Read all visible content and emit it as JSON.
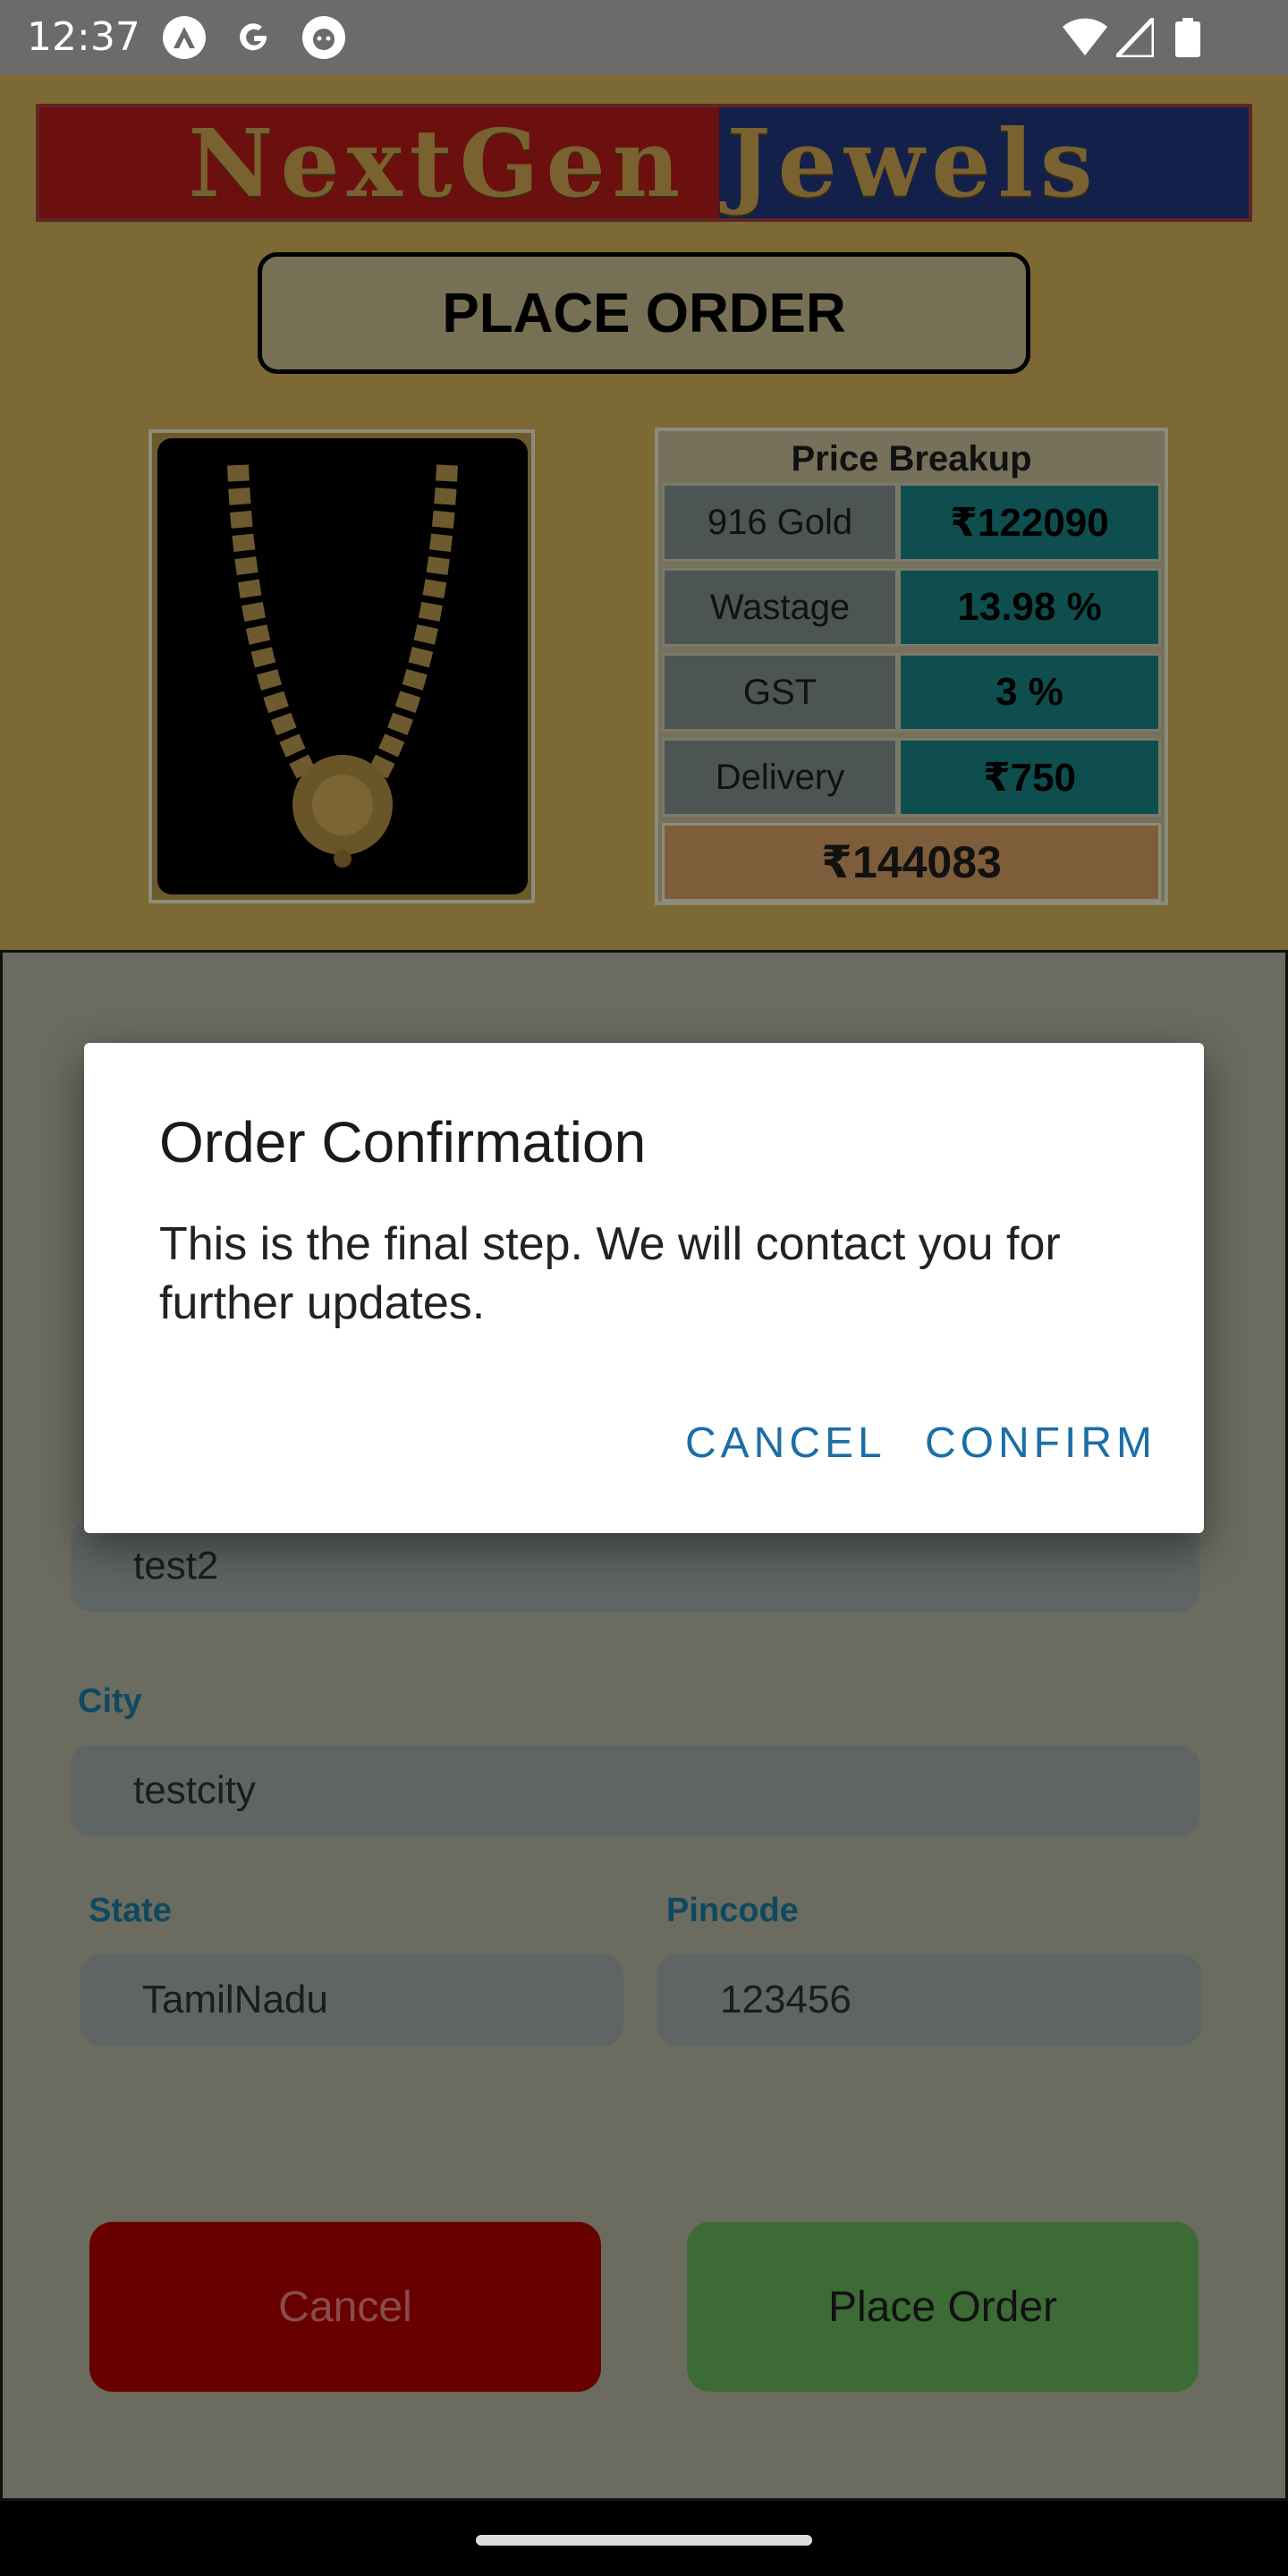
{
  "status_bar": {
    "time": "12:37",
    "left_icons": [
      "app-a-icon",
      "google-g-icon",
      "android-head-icon"
    ],
    "right_icons": [
      "wifi-icon",
      "signal-icon",
      "battery-icon"
    ]
  },
  "brand": {
    "name": "NextGen Jewels",
    "banner_colors": [
      "#6c0f0f",
      "#13214a"
    ]
  },
  "page": {
    "title": "PLACE ORDER"
  },
  "product": {
    "image": "gold-necklace-icon"
  },
  "price_breakup": {
    "header": "Price Breakup",
    "rows": [
      {
        "label": "916 Gold",
        "value": "₹122090"
      },
      {
        "label": "Wastage",
        "value": "13.98 %"
      },
      {
        "label": "GST",
        "value": "3 %"
      },
      {
        "label": "Delivery",
        "value": "₹750"
      }
    ],
    "total": "₹144083"
  },
  "form": {
    "address2": {
      "value": "test2"
    },
    "city": {
      "label": "City",
      "value": "testcity"
    },
    "state": {
      "label": "State",
      "value": "TamilNadu"
    },
    "pincode": {
      "label": "Pincode",
      "value": "123456"
    }
  },
  "actions": {
    "cancel_label": "Cancel",
    "place_order_label": "Place Order"
  },
  "dialog": {
    "title": "Order Confirmation",
    "message": "This is the final step. We will contact you for further updates.",
    "cancel_label": "CANCEL",
    "confirm_label": "CONFIRM",
    "accent_color": "#1b6ea8"
  },
  "colors": {
    "cancel_button": "#690000",
    "place_order_button": "#3d6b35",
    "field_label": "#0f4960"
  }
}
